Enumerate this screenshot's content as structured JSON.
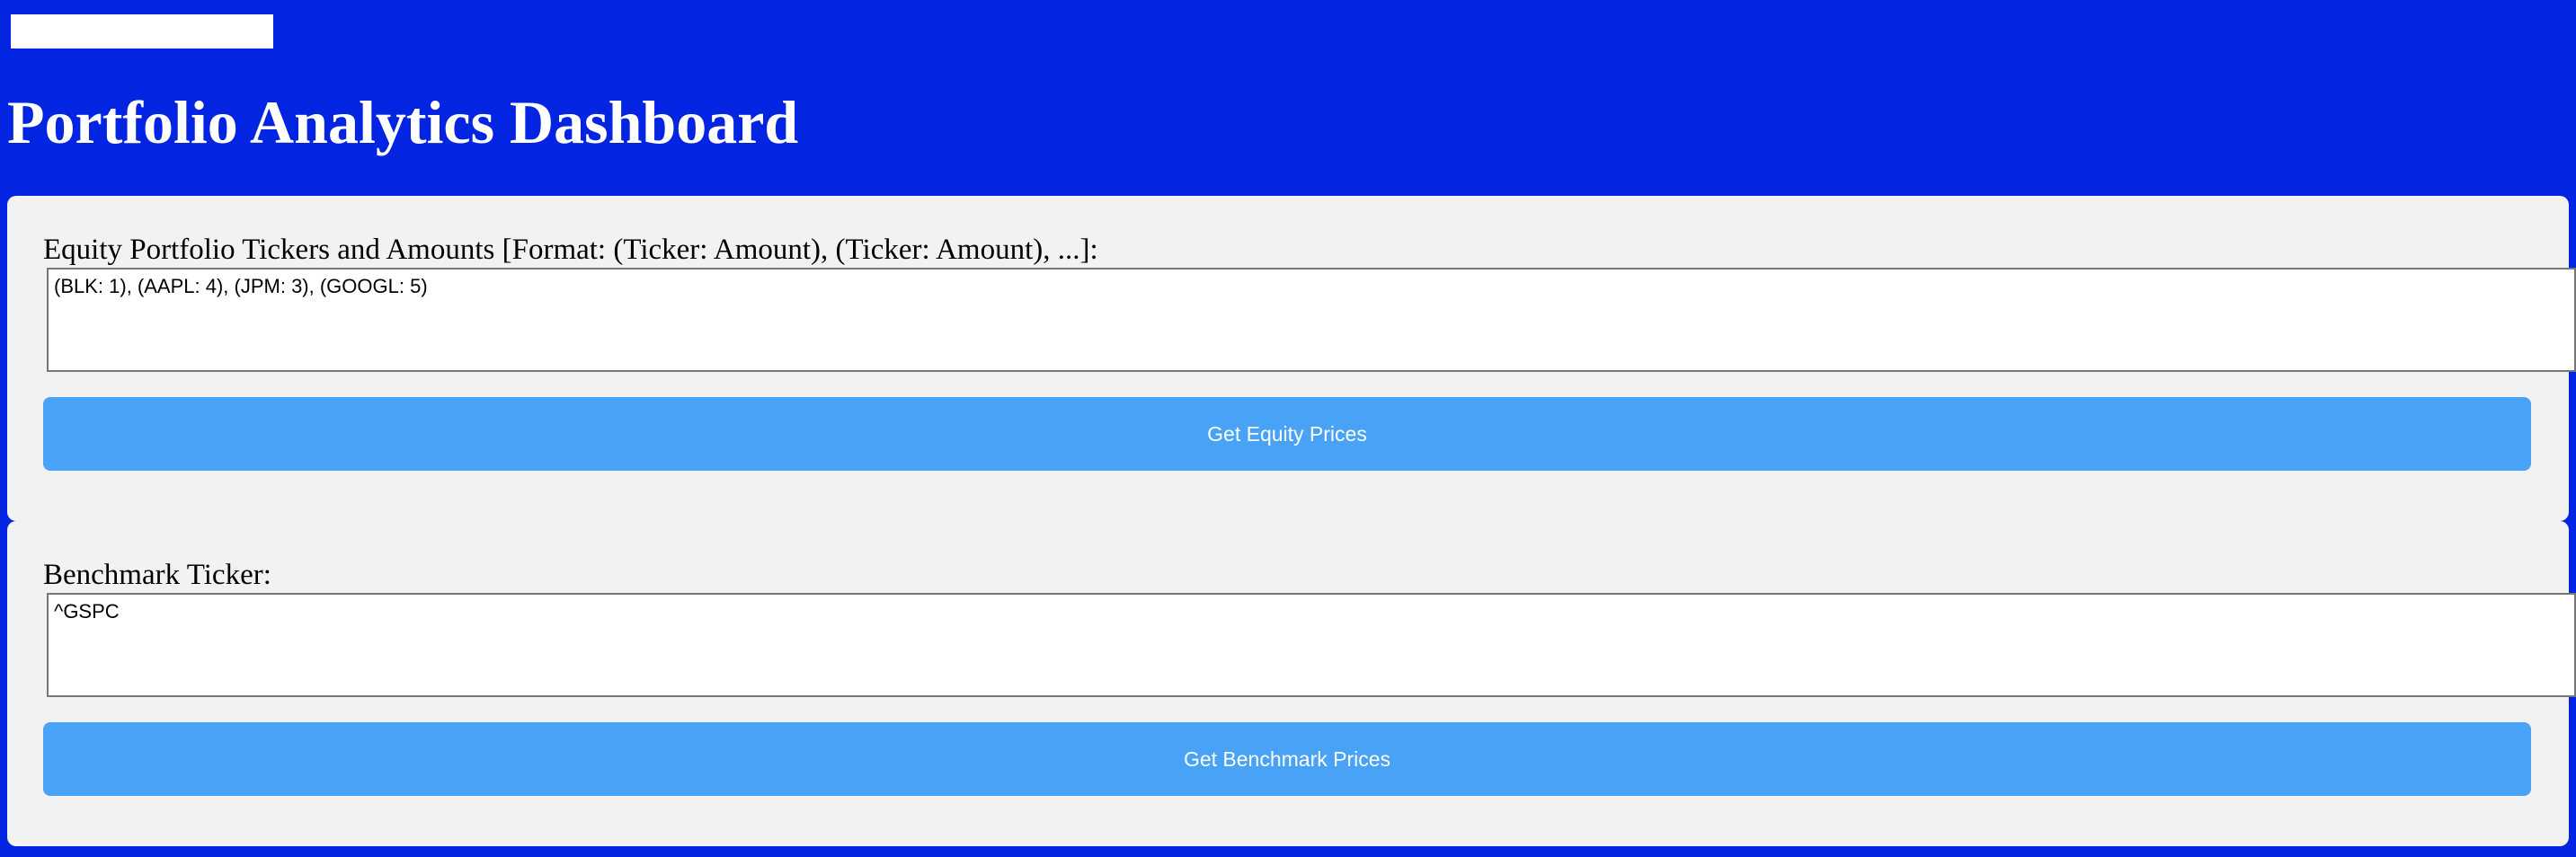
{
  "header": {
    "title": "Portfolio Analytics Dashboard"
  },
  "top_field": {
    "value": ""
  },
  "equity": {
    "label": "Equity Portfolio Tickers and Amounts [Format: (Ticker: Amount), (Ticker: Amount), ...]:",
    "value": "(BLK: 1), (AAPL: 4), (JPM: 3), (GOOGL: 5)",
    "button_label": "Get Equity Prices"
  },
  "benchmark": {
    "label": "Benchmark Ticker:",
    "value": "^GSPC",
    "button_label": "Get Benchmark Prices"
  },
  "colors": {
    "page_background": "#0325e2",
    "panel_background": "#f2f2f2",
    "button_background": "#48a3f6",
    "button_text": "#ffffff",
    "title_text": "#ffffff"
  }
}
